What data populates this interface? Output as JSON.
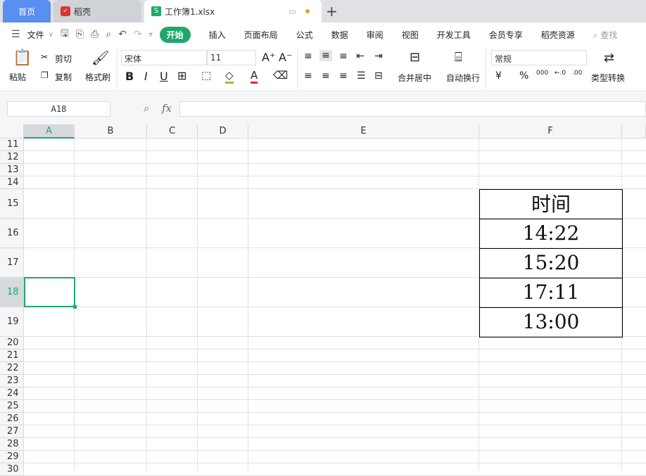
{
  "tabs": {
    "home": "首页",
    "daoke": "稻壳",
    "workbook": "工作簿1.xlsx",
    "new_tab": "+"
  },
  "menu": {
    "file": "文件",
    "items": [
      "开始",
      "插入",
      "页面布局",
      "公式",
      "数据",
      "审阅",
      "视图",
      "开发工具",
      "会员专享",
      "稻壳资源"
    ],
    "search": "查找"
  },
  "ribbon": {
    "paste": "粘贴",
    "cut": "剪切",
    "copy": "复制",
    "format_painter": "格式刷",
    "font": "宋体",
    "font_size": "11",
    "merge_center": "合并居中",
    "wrap": "自动换行",
    "number_format": "常规",
    "type_convert": "类型转换",
    "currency": "¥",
    "percent": "%",
    "thousands": "000",
    "inc_dec": "←.0",
    "dec_dec": ".00"
  },
  "formula_bar": {
    "name_box": "A18",
    "fx": "fx",
    "formula": ""
  },
  "colors": {
    "accent": "#1fa86b",
    "home_tab": "#5a8ef0"
  },
  "sheet": {
    "columns": [
      "A",
      "B",
      "C",
      "D",
      "E",
      "F"
    ],
    "rows": [
      "11",
      "12",
      "13",
      "14",
      "15",
      "16",
      "17",
      "18",
      "19",
      "20",
      "21",
      "22",
      "23",
      "24",
      "25",
      "26",
      "27",
      "28",
      "29",
      "30"
    ],
    "active_cell": "A18",
    "table": {
      "header": "时间",
      "values": [
        "14:22",
        "15:20",
        "17:11",
        "13:00"
      ]
    }
  }
}
